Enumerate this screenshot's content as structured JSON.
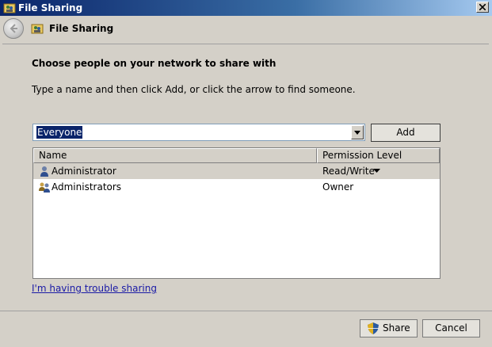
{
  "window": {
    "title": "File Sharing"
  },
  "header": {
    "title": "File Sharing"
  },
  "main": {
    "heading": "Choose people on your network to share with",
    "instructions": "Type a name and then click Add, or click the arrow to find someone.",
    "name_input": {
      "value": "Everyone"
    },
    "add_label": "Add",
    "table": {
      "columns": [
        "Name",
        "Permission Level"
      ],
      "rows": [
        {
          "name": "Administrator",
          "permission": "Read/Write",
          "icon": "user-icon",
          "selected": true
        },
        {
          "name": "Administrators",
          "permission": "Owner",
          "icon": "group-icon",
          "selected": false
        }
      ]
    },
    "trouble_link": "I'm having trouble sharing"
  },
  "footer": {
    "share_label": "Share",
    "cancel_label": "Cancel"
  },
  "colors": {
    "titlebar_start": "#0a246a",
    "titlebar_end": "#a6caf0",
    "dialog_bg": "#d4d0c8",
    "selection": "#0a246a",
    "link": "#1a1aa6"
  }
}
